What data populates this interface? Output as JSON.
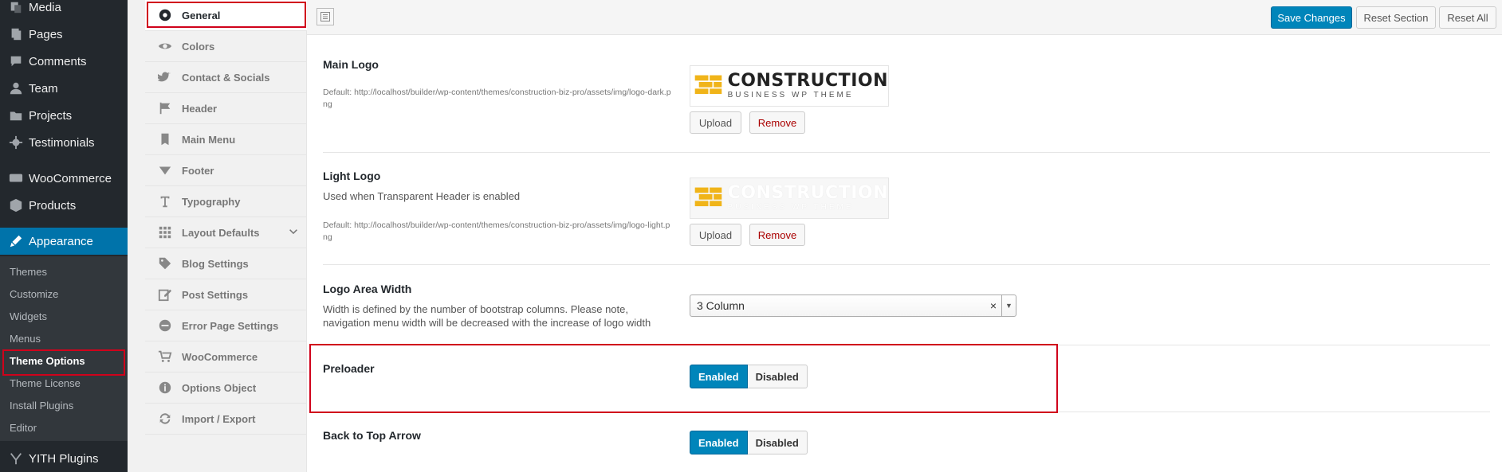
{
  "wp_menu": {
    "items": [
      {
        "label": "Media",
        "icon": "media-icon"
      },
      {
        "label": "Pages",
        "icon": "pages-icon"
      },
      {
        "label": "Comments",
        "icon": "comments-icon"
      },
      {
        "label": "Team",
        "icon": "team-icon"
      },
      {
        "label": "Projects",
        "icon": "projects-icon"
      },
      {
        "label": "Testimonials",
        "icon": "testimonials-icon"
      },
      {
        "label": "WooCommerce",
        "icon": "woocommerce-icon"
      },
      {
        "label": "Products",
        "icon": "products-icon"
      },
      {
        "label": "Appearance",
        "icon": "appearance-icon"
      },
      {
        "label": "YITH Plugins",
        "icon": "yith-icon"
      }
    ],
    "submenu": [
      "Themes",
      "Customize",
      "Widgets",
      "Menus",
      "Theme Options",
      "Theme License",
      "Install Plugins",
      "Editor"
    ]
  },
  "options_nav": [
    {
      "label": "General",
      "icon": "general-icon"
    },
    {
      "label": "Colors",
      "icon": "eye-icon"
    },
    {
      "label": "Contact & Socials",
      "icon": "twitter-icon"
    },
    {
      "label": "Header",
      "icon": "flag-icon"
    },
    {
      "label": "Main Menu",
      "icon": "book-icon"
    },
    {
      "label": "Footer",
      "icon": "triangle-down-icon"
    },
    {
      "label": "Typography",
      "icon": "typography-icon"
    },
    {
      "label": "Layout Defaults",
      "icon": "grid-icon"
    },
    {
      "label": "Blog Settings",
      "icon": "tags-icon"
    },
    {
      "label": "Post Settings",
      "icon": "edit-icon"
    },
    {
      "label": "Error Page Settings",
      "icon": "minus-circle-icon"
    },
    {
      "label": "WooCommerce",
      "icon": "cart-icon"
    },
    {
      "label": "Options Object",
      "icon": "info-icon"
    },
    {
      "label": "Import / Export",
      "icon": "refresh-icon"
    }
  ],
  "toolbar": {
    "save": "Save Changes",
    "reset_section": "Reset Section",
    "reset_all": "Reset All"
  },
  "fields": {
    "main_logo": {
      "title": "Main Logo",
      "default": "Default: http://localhost/builder/wp-content/themes/construction-biz-pro/assets/img/logo-dark.png",
      "upload": "Upload",
      "remove": "Remove"
    },
    "light_logo": {
      "title": "Light Logo",
      "subtitle": "Used when Transparent Header is enabled",
      "default": "Default: http://localhost/builder/wp-content/themes/construction-biz-pro/assets/img/logo-light.png",
      "upload": "Upload",
      "remove": "Remove"
    },
    "logo_width": {
      "title": "Logo Area Width",
      "subtitle": "Width is defined by the number of bootstrap columns. Please note, navigation menu width will be decreased with the increase of logo width",
      "value": "3 Column",
      "clear": "×"
    },
    "preloader": {
      "title": "Preloader",
      "on": "Enabled",
      "off": "Disabled"
    },
    "back_to_top": {
      "title": "Back to Top Arrow",
      "on": "Enabled",
      "off": "Disabled"
    }
  },
  "logo": {
    "word": "CONSTRUCTION",
    "tagline": "BUSINESS WP THEME",
    "brand_color": "#f0b419"
  },
  "colors": {
    "wp_dark": "#23282d",
    "wp_blue": "#0073aa",
    "highlight": "#d0021b"
  }
}
